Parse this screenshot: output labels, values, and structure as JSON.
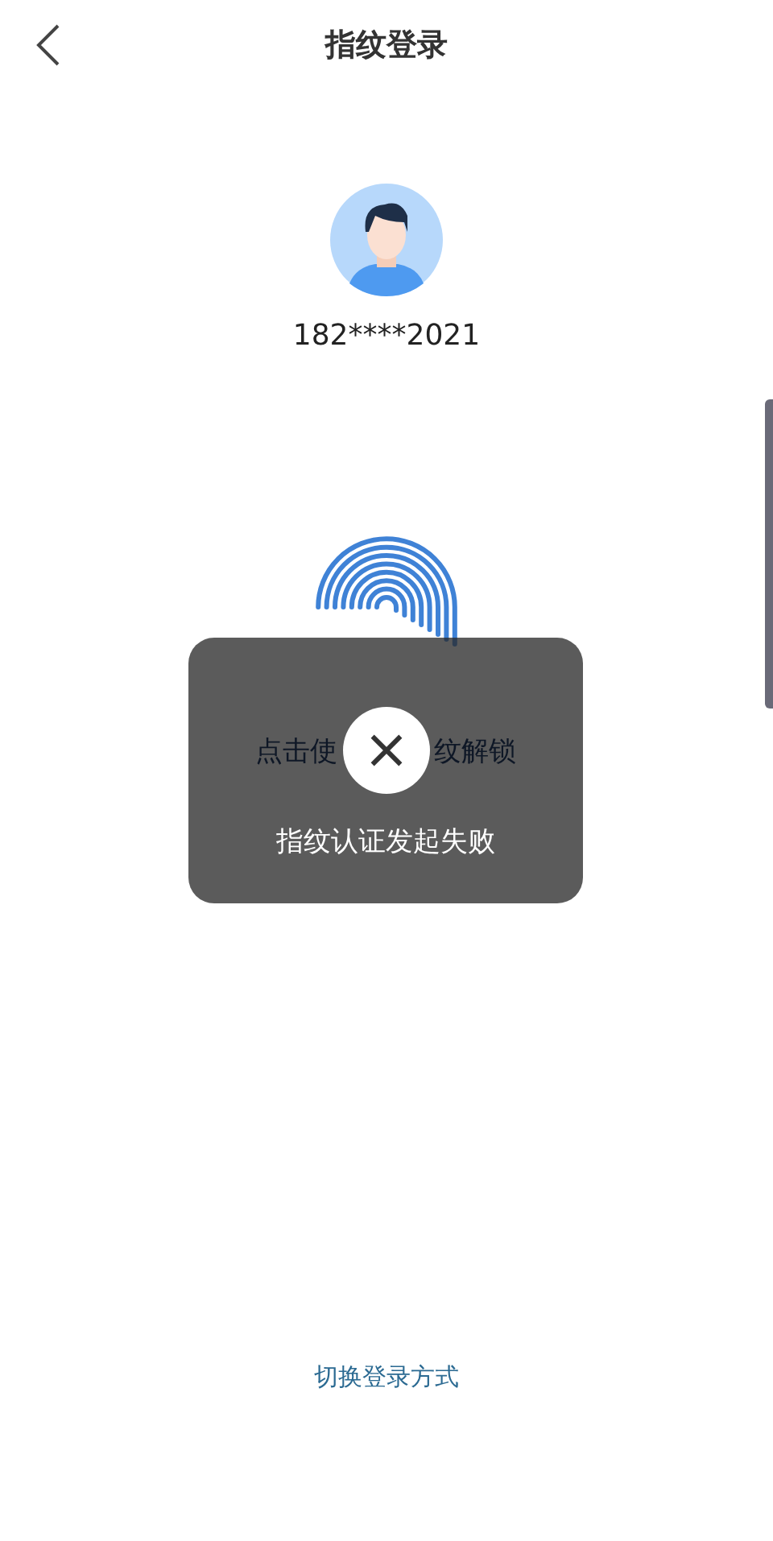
{
  "header": {
    "title": "指纹登录"
  },
  "account": {
    "phone": "182****2021"
  },
  "fingerprint_hint": {
    "left": "点击使",
    "right": "纹解锁"
  },
  "toast": {
    "message": "指纹认证发起失败"
  },
  "switch_link": "切换登录方式"
}
